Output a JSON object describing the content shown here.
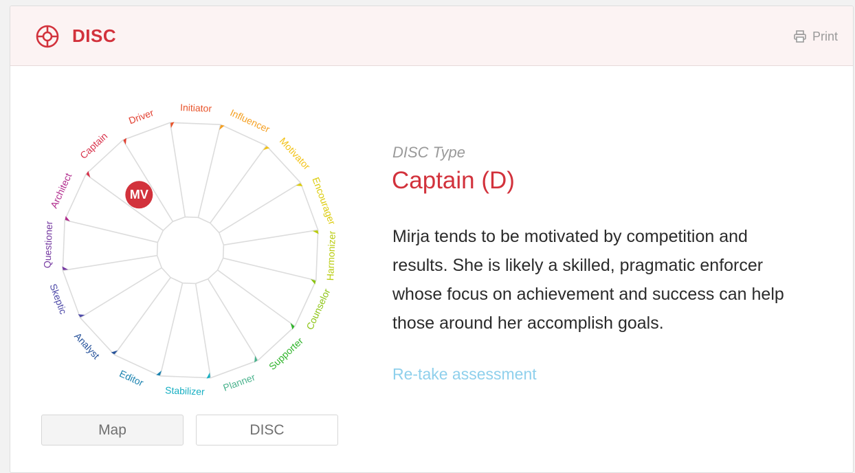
{
  "header": {
    "title": "DISC",
    "print_label": "Print",
    "icon": "compass-target-icon",
    "accent_color": "#d2323c"
  },
  "wheel": {
    "marker_label": "MV",
    "marker_color": "#d2323c",
    "marker_segment": "Captain",
    "segments": [
      {
        "label": "Initiator",
        "color": "#e8532a"
      },
      {
        "label": "Influencer",
        "color": "#f4a023"
      },
      {
        "label": "Motivator",
        "color": "#f2c218"
      },
      {
        "label": "Encourager",
        "color": "#dccb0a"
      },
      {
        "label": "Harmonizer",
        "color": "#b9cc0d"
      },
      {
        "label": "Counselor",
        "color": "#8cc413"
      },
      {
        "label": "Supporter",
        "color": "#2fb42a"
      },
      {
        "label": "Planner",
        "color": "#49b28c"
      },
      {
        "label": "Stabilizer",
        "color": "#17afc2"
      },
      {
        "label": "Editor",
        "color": "#1a82b0"
      },
      {
        "label": "Analyst",
        "color": "#25519a"
      },
      {
        "label": "Skeptic",
        "color": "#4e4aa8"
      },
      {
        "label": "Questioner",
        "color": "#7438a0"
      },
      {
        "label": "Architect",
        "color": "#b02a8c"
      },
      {
        "label": "Captain",
        "color": "#d8314a"
      },
      {
        "label": "Driver",
        "color": "#e23f30"
      }
    ]
  },
  "tabs": {
    "map_label": "Map",
    "disc_label": "DISC"
  },
  "result": {
    "type_label": "DISC Type",
    "type_value": "Captain (D)",
    "description": "Mirja tends to be motivated by competition and results. She is likely a skilled, pragmatic enforcer whose focus on achievement and success can help those around her accomplish goals.",
    "retake_label": "Re-take assessment"
  }
}
